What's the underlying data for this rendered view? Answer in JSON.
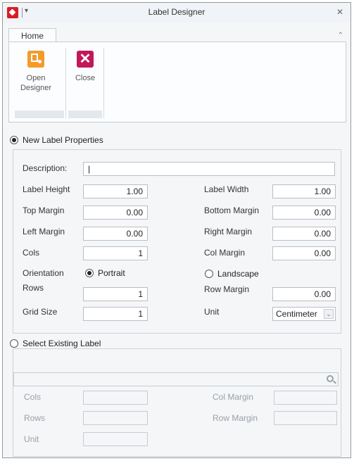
{
  "window": {
    "title": "Label Designer",
    "quick_access_glyph": "|▾",
    "close_glyph": "✕",
    "collapse_glyph": "⌃"
  },
  "ribbon": {
    "tab_home": "Home",
    "open_designer": {
      "line1": "Open",
      "line2": "Designer",
      "icon": "save-design-icon"
    },
    "close": {
      "label": "Close",
      "icon": "close-icon"
    }
  },
  "new_label": {
    "radio_label": "New Label Properties",
    "selected": true,
    "description_label": "Description:",
    "description_value": "|",
    "label_height": {
      "label": "Label Height",
      "value": "1.00"
    },
    "label_width": {
      "label": "Label Width",
      "value": "1.00"
    },
    "top_margin": {
      "label": "Top Margin",
      "value": "0.00"
    },
    "bottom_margin": {
      "label": "Bottom Margin",
      "value": "0.00"
    },
    "left_margin": {
      "label": "Left Margin",
      "value": "0.00"
    },
    "right_margin": {
      "label": "Right Margin",
      "value": "0.00"
    },
    "cols": {
      "label": "Cols",
      "value": "1"
    },
    "col_margin": {
      "label": "Col Margin",
      "value": "0.00"
    },
    "orientation_label": "Orientation",
    "portrait": "Portrait",
    "landscape": "Landscape",
    "rows": {
      "label": "Rows",
      "value": "1"
    },
    "row_margin": {
      "label": "Row Margin",
      "value": "0.00"
    },
    "grid_size": {
      "label": "Grid Size",
      "value": "1"
    },
    "unit": {
      "label": "Unit",
      "value": "Centimeter",
      "dropdown_glyph": "⌄"
    }
  },
  "existing_label": {
    "radio_label": "Select Existing Label",
    "selected": false,
    "cols_label": "Cols",
    "col_margin_label": "Col Margin",
    "rows_label": "Rows",
    "row_margin_label": "Row Margin",
    "unit_label": "Unit"
  }
}
